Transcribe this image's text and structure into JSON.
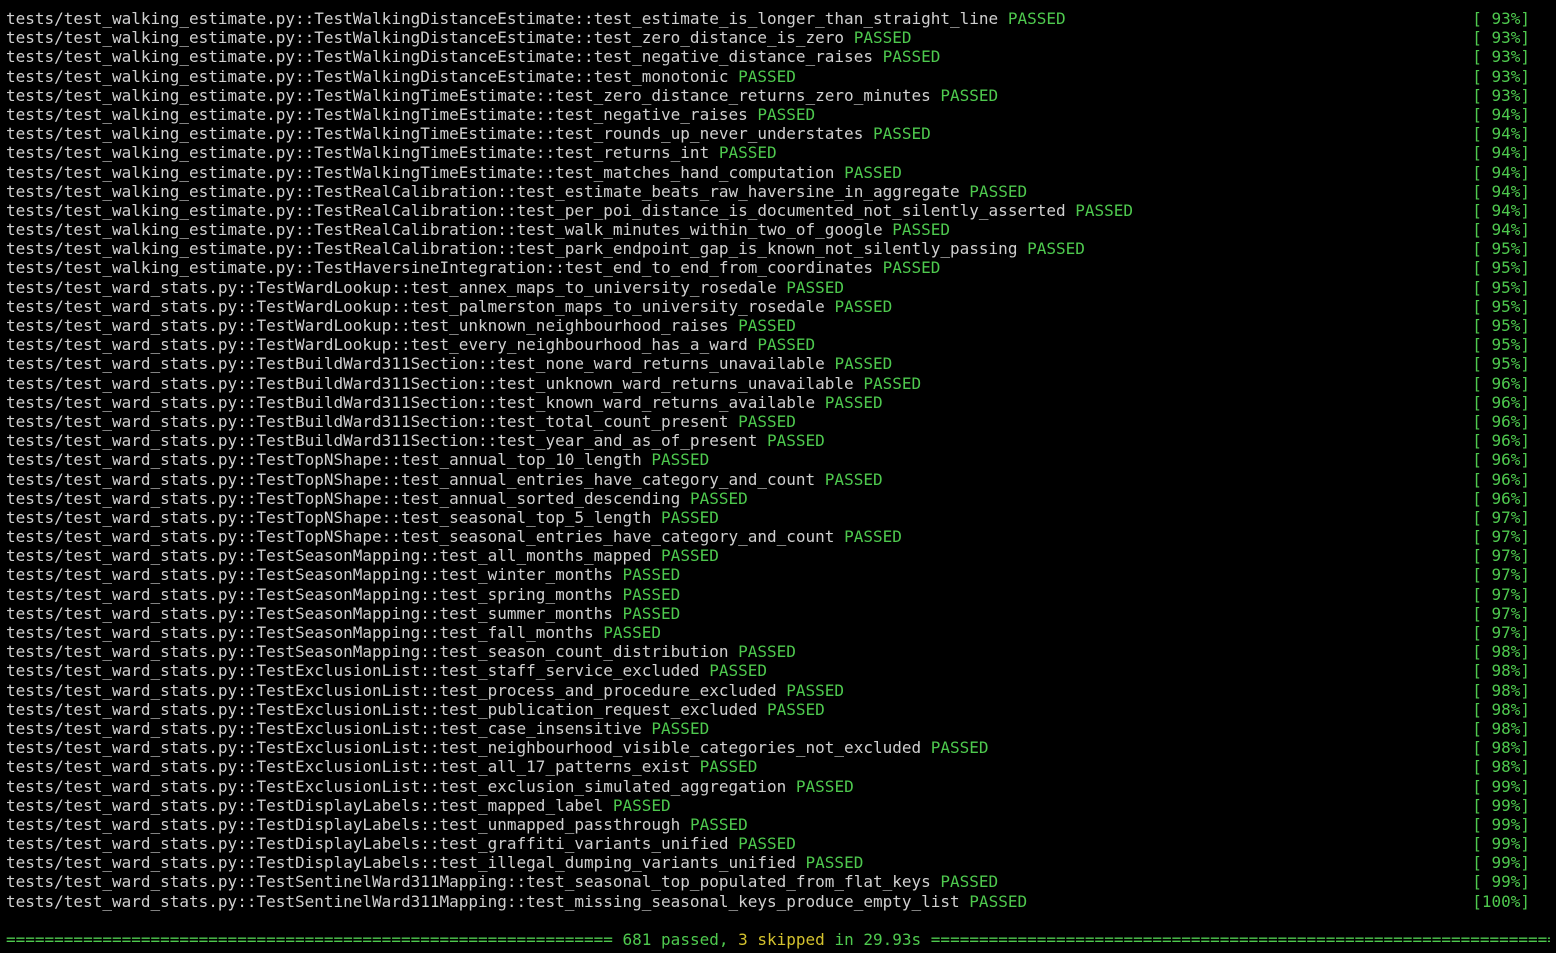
{
  "colors": {
    "background": "#000000",
    "text": "#d0d0d0",
    "passed": "#4ec94e",
    "skipped": "#d4c22e"
  },
  "results": [
    {
      "id": "tests/test_walking_estimate.py::TestWalkingDistanceEstimate::test_estimate_is_longer_than_straight_line",
      "status": "PASSED",
      "pct": "[ 93%]"
    },
    {
      "id": "tests/test_walking_estimate.py::TestWalkingDistanceEstimate::test_zero_distance_is_zero",
      "status": "PASSED",
      "pct": "[ 93%]"
    },
    {
      "id": "tests/test_walking_estimate.py::TestWalkingDistanceEstimate::test_negative_distance_raises",
      "status": "PASSED",
      "pct": "[ 93%]"
    },
    {
      "id": "tests/test_walking_estimate.py::TestWalkingDistanceEstimate::test_monotonic",
      "status": "PASSED",
      "pct": "[ 93%]"
    },
    {
      "id": "tests/test_walking_estimate.py::TestWalkingTimeEstimate::test_zero_distance_returns_zero_minutes",
      "status": "PASSED",
      "pct": "[ 93%]"
    },
    {
      "id": "tests/test_walking_estimate.py::TestWalkingTimeEstimate::test_negative_raises",
      "status": "PASSED",
      "pct": "[ 94%]"
    },
    {
      "id": "tests/test_walking_estimate.py::TestWalkingTimeEstimate::test_rounds_up_never_understates",
      "status": "PASSED",
      "pct": "[ 94%]"
    },
    {
      "id": "tests/test_walking_estimate.py::TestWalkingTimeEstimate::test_returns_int",
      "status": "PASSED",
      "pct": "[ 94%]"
    },
    {
      "id": "tests/test_walking_estimate.py::TestWalkingTimeEstimate::test_matches_hand_computation",
      "status": "PASSED",
      "pct": "[ 94%]"
    },
    {
      "id": "tests/test_walking_estimate.py::TestRealCalibration::test_estimate_beats_raw_haversine_in_aggregate",
      "status": "PASSED",
      "pct": "[ 94%]"
    },
    {
      "id": "tests/test_walking_estimate.py::TestRealCalibration::test_per_poi_distance_is_documented_not_silently_asserted",
      "status": "PASSED",
      "pct": "[ 94%]"
    },
    {
      "id": "tests/test_walking_estimate.py::TestRealCalibration::test_walk_minutes_within_two_of_google",
      "status": "PASSED",
      "pct": "[ 94%]"
    },
    {
      "id": "tests/test_walking_estimate.py::TestRealCalibration::test_park_endpoint_gap_is_known_not_silently_passing",
      "status": "PASSED",
      "pct": "[ 95%]"
    },
    {
      "id": "tests/test_walking_estimate.py::TestHaversineIntegration::test_end_to_end_from_coordinates",
      "status": "PASSED",
      "pct": "[ 95%]"
    },
    {
      "id": "tests/test_ward_stats.py::TestWardLookup::test_annex_maps_to_university_rosedale",
      "status": "PASSED",
      "pct": "[ 95%]"
    },
    {
      "id": "tests/test_ward_stats.py::TestWardLookup::test_palmerston_maps_to_university_rosedale",
      "status": "PASSED",
      "pct": "[ 95%]"
    },
    {
      "id": "tests/test_ward_stats.py::TestWardLookup::test_unknown_neighbourhood_raises",
      "status": "PASSED",
      "pct": "[ 95%]"
    },
    {
      "id": "tests/test_ward_stats.py::TestWardLookup::test_every_neighbourhood_has_a_ward",
      "status": "PASSED",
      "pct": "[ 95%]"
    },
    {
      "id": "tests/test_ward_stats.py::TestBuildWard311Section::test_none_ward_returns_unavailable",
      "status": "PASSED",
      "pct": "[ 95%]"
    },
    {
      "id": "tests/test_ward_stats.py::TestBuildWard311Section::test_unknown_ward_returns_unavailable",
      "status": "PASSED",
      "pct": "[ 96%]"
    },
    {
      "id": "tests/test_ward_stats.py::TestBuildWard311Section::test_known_ward_returns_available",
      "status": "PASSED",
      "pct": "[ 96%]"
    },
    {
      "id": "tests/test_ward_stats.py::TestBuildWard311Section::test_total_count_present",
      "status": "PASSED",
      "pct": "[ 96%]"
    },
    {
      "id": "tests/test_ward_stats.py::TestBuildWard311Section::test_year_and_as_of_present",
      "status": "PASSED",
      "pct": "[ 96%]"
    },
    {
      "id": "tests/test_ward_stats.py::TestTopNShape::test_annual_top_10_length",
      "status": "PASSED",
      "pct": "[ 96%]"
    },
    {
      "id": "tests/test_ward_stats.py::TestTopNShape::test_annual_entries_have_category_and_count",
      "status": "PASSED",
      "pct": "[ 96%]"
    },
    {
      "id": "tests/test_ward_stats.py::TestTopNShape::test_annual_sorted_descending",
      "status": "PASSED",
      "pct": "[ 96%]"
    },
    {
      "id": "tests/test_ward_stats.py::TestTopNShape::test_seasonal_top_5_length",
      "status": "PASSED",
      "pct": "[ 97%]"
    },
    {
      "id": "tests/test_ward_stats.py::TestTopNShape::test_seasonal_entries_have_category_and_count",
      "status": "PASSED",
      "pct": "[ 97%]"
    },
    {
      "id": "tests/test_ward_stats.py::TestSeasonMapping::test_all_months_mapped",
      "status": "PASSED",
      "pct": "[ 97%]"
    },
    {
      "id": "tests/test_ward_stats.py::TestSeasonMapping::test_winter_months",
      "status": "PASSED",
      "pct": "[ 97%]"
    },
    {
      "id": "tests/test_ward_stats.py::TestSeasonMapping::test_spring_months",
      "status": "PASSED",
      "pct": "[ 97%]"
    },
    {
      "id": "tests/test_ward_stats.py::TestSeasonMapping::test_summer_months",
      "status": "PASSED",
      "pct": "[ 97%]"
    },
    {
      "id": "tests/test_ward_stats.py::TestSeasonMapping::test_fall_months",
      "status": "PASSED",
      "pct": "[ 97%]"
    },
    {
      "id": "tests/test_ward_stats.py::TestSeasonMapping::test_season_count_distribution",
      "status": "PASSED",
      "pct": "[ 98%]"
    },
    {
      "id": "tests/test_ward_stats.py::TestExclusionList::test_staff_service_excluded",
      "status": "PASSED",
      "pct": "[ 98%]"
    },
    {
      "id": "tests/test_ward_stats.py::TestExclusionList::test_process_and_procedure_excluded",
      "status": "PASSED",
      "pct": "[ 98%]"
    },
    {
      "id": "tests/test_ward_stats.py::TestExclusionList::test_publication_request_excluded",
      "status": "PASSED",
      "pct": "[ 98%]"
    },
    {
      "id": "tests/test_ward_stats.py::TestExclusionList::test_case_insensitive",
      "status": "PASSED",
      "pct": "[ 98%]"
    },
    {
      "id": "tests/test_ward_stats.py::TestExclusionList::test_neighbourhood_visible_categories_not_excluded",
      "status": "PASSED",
      "pct": "[ 98%]"
    },
    {
      "id": "tests/test_ward_stats.py::TestExclusionList::test_all_17_patterns_exist",
      "status": "PASSED",
      "pct": "[ 98%]"
    },
    {
      "id": "tests/test_ward_stats.py::TestExclusionList::test_exclusion_simulated_aggregation",
      "status": "PASSED",
      "pct": "[ 99%]"
    },
    {
      "id": "tests/test_ward_stats.py::TestDisplayLabels::test_mapped_label",
      "status": "PASSED",
      "pct": "[ 99%]"
    },
    {
      "id": "tests/test_ward_stats.py::TestDisplayLabels::test_unmapped_passthrough",
      "status": "PASSED",
      "pct": "[ 99%]"
    },
    {
      "id": "tests/test_ward_stats.py::TestDisplayLabels::test_graffiti_variants_unified",
      "status": "PASSED",
      "pct": "[ 99%]"
    },
    {
      "id": "tests/test_ward_stats.py::TestDisplayLabels::test_illegal_dumping_variants_unified",
      "status": "PASSED",
      "pct": "[ 99%]"
    },
    {
      "id": "tests/test_ward_stats.py::TestSentinelWard311Mapping::test_seasonal_top_populated_from_flat_keys",
      "status": "PASSED",
      "pct": "[ 99%]"
    },
    {
      "id": "tests/test_ward_stats.py::TestSentinelWard311Mapping::test_missing_seasonal_keys_produce_empty_list",
      "status": "PASSED",
      "pct": "[100%]"
    }
  ],
  "summary": {
    "rule_left": "===============================================================",
    "passed": "681 passed",
    "sep": ", ",
    "skipped": "3 skipped",
    "time": "in 29.93s",
    "rule_right": "================================================================="
  }
}
